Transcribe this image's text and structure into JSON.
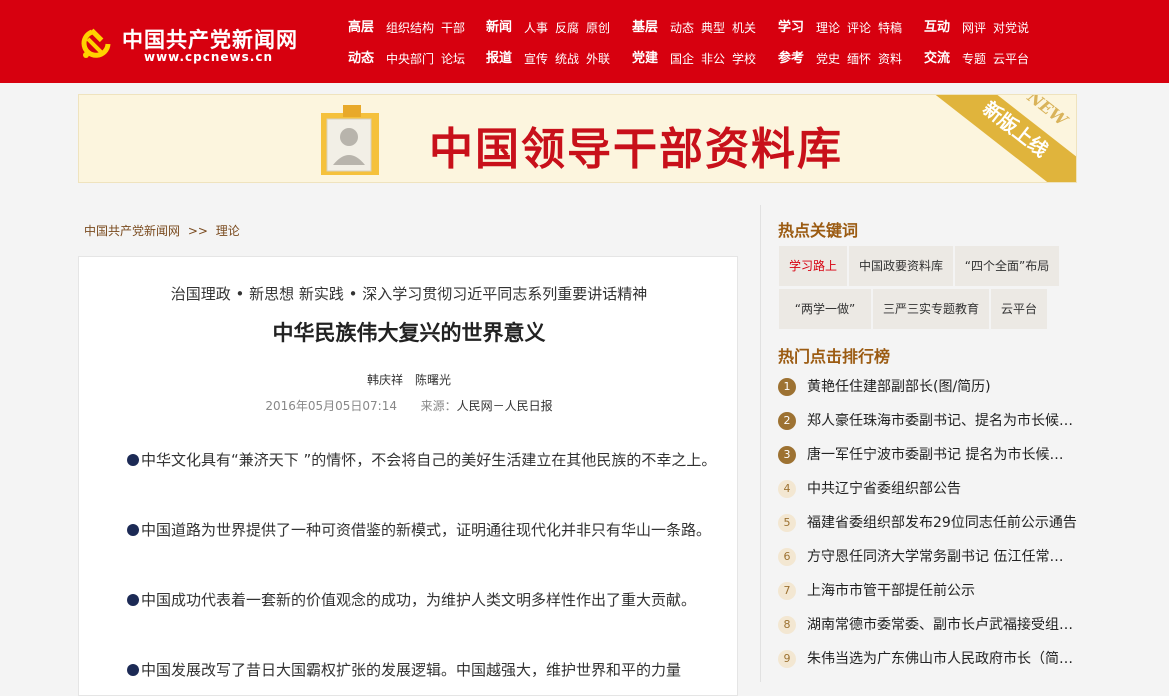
{
  "logo": {
    "title": "中国共产党新闻网",
    "url": "www.cpcnews.cn"
  },
  "nav": [
    {
      "head1": "高层",
      "row1": [
        "组织结构",
        "干部"
      ],
      "head2": "动态",
      "row2": [
        "中央部门",
        "论坛"
      ]
    },
    {
      "head1": "新闻",
      "row1": [
        "人事",
        "反腐",
        "原创"
      ],
      "head2": "报道",
      "row2": [
        "宣传",
        "统战",
        "外联"
      ]
    },
    {
      "head1": "基层",
      "row1": [
        "动态",
        "典型",
        "机关"
      ],
      "head2": "党建",
      "row2": [
        "国企",
        "非公",
        "学校"
      ]
    },
    {
      "head1": "学习",
      "row1": [
        "理论",
        "评论",
        "特稿"
      ],
      "head2": "参考",
      "row2": [
        "党史",
        "缅怀",
        "资料"
      ]
    },
    {
      "head1": "互动",
      "row1": [
        "网评",
        "对党说"
      ],
      "head2": "交流",
      "row2": [
        "专题",
        "云平台"
      ]
    }
  ],
  "banner": {
    "title": "中国领导干部资料库",
    "ribbon": "新版上线",
    "badge": "NEW"
  },
  "breadcrumb": {
    "home": "中国共产党新闻网",
    "sep": ">>",
    "section": "理论"
  },
  "article": {
    "kicker": "治国理政 • 新思想 新实践 • 深入学习贯彻习近平同志系列重要讲话精神",
    "title": "中华民族伟大复兴的世界意义",
    "authors": "韩庆祥　陈曙光",
    "date": "2016年05月05日07:14",
    "source_label": "来源：",
    "source": "人民网－人民日报",
    "paragraphs": [
      "中华文化具有“兼济天下 ”的情怀，不会将自己的美好生活建立在其他民族的不幸之上。",
      "中国道路为世界提供了一种可资借鉴的新模式，证明通往现代化并非只有华山一条路。",
      "中国成功代表着一套新的价值观念的成功，为维护人类文明多样性作出了重大贡献。",
      "中国发展改写了昔日大国霸权扩张的发展逻辑。中国越强大，维护世界和平的力量"
    ]
  },
  "sidebar": {
    "keywords_title": "热点关键词",
    "keywords": [
      "学习路上",
      "中国政要资料库",
      "“四个全面”布局",
      "“两学一做”",
      "三严三实专题教育",
      "云平台"
    ],
    "ranking_title": "热门点击排行榜",
    "ranking": [
      "黄艳任住建部副部长(图/简历)",
      "郑人豪任珠海市委副书记、提名为市长候选人",
      "唐一军任宁波市委副书记 提名为市长候选人",
      "中共辽宁省委组织部公告",
      "福建省委组织部发布29位同志任前公示通告",
      "方守恩任同济大学常务副书记 伍江任常务副校长",
      "上海市市管干部提任前公示",
      "湖南常德市委常委、副市长卢武福接受组织调查",
      "朱伟当选为广东佛山市人民政府市长（简历）"
    ]
  },
  "colors": {
    "header": "#d7000f",
    "accent_brown": "#9b5b12"
  }
}
